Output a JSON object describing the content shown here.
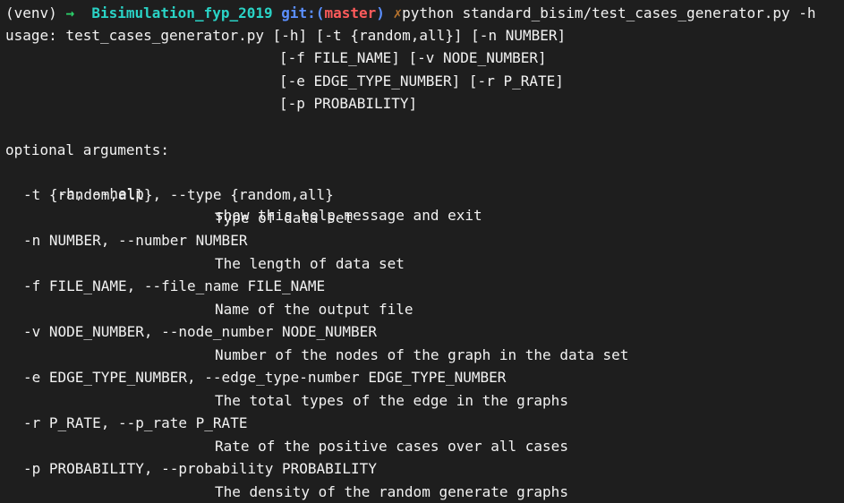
{
  "prompt": {
    "venv": "(venv)",
    "arrow": "→",
    "directory": "Bisimulation_fyp_2019",
    "git_label": "git:",
    "paren_open": "(",
    "branch": "master",
    "paren_close": ")",
    "dirty_marker": "✗",
    "command": "python standard_bisim/test_cases_generator.py -h"
  },
  "usage": [
    "usage: test_cases_generator.py [-h] [-t {random,all}] [-n NUMBER]",
    "[-f FILE_NAME] [-v NODE_NUMBER]",
    "[-e EDGE_TYPE_NUMBER] [-r P_RATE]",
    "[-p PROBABILITY]"
  ],
  "section_header": "optional arguments:",
  "arguments": [
    {
      "flag": "-h, --help",
      "description": "show this help message and exit",
      "inline": true
    },
    {
      "flag": "-t {random,all}, --type {random,all}",
      "description": "Type of data set",
      "inline": false
    },
    {
      "flag": "-n NUMBER, --number NUMBER",
      "description": "The length of data set",
      "inline": false
    },
    {
      "flag": "-f FILE_NAME, --file_name FILE_NAME",
      "description": "Name of the output file",
      "inline": false
    },
    {
      "flag": "-v NODE_NUMBER, --node_number NODE_NUMBER",
      "description": "Number of the nodes of the graph in the data set",
      "inline": false
    },
    {
      "flag": "-e EDGE_TYPE_NUMBER, --edge_type-number EDGE_TYPE_NUMBER",
      "description": "The total types of the edge in the graphs",
      "inline": false
    },
    {
      "flag": "-r P_RATE, --p_rate P_RATE",
      "description": "Rate of the positive cases over all cases",
      "inline": false
    },
    {
      "flag": "-p PROBABILITY, --probability PROBABILITY",
      "description": "The density of the random generate graphs",
      "inline": false
    }
  ],
  "colors": {
    "background": "#1e1e1e",
    "text": "#f2f2f2",
    "arrow": "#2bd16b",
    "directory": "#2ad3c6",
    "git": "#5b8fff",
    "branch": "#ff5b5b",
    "dirty": "#b8742e"
  }
}
